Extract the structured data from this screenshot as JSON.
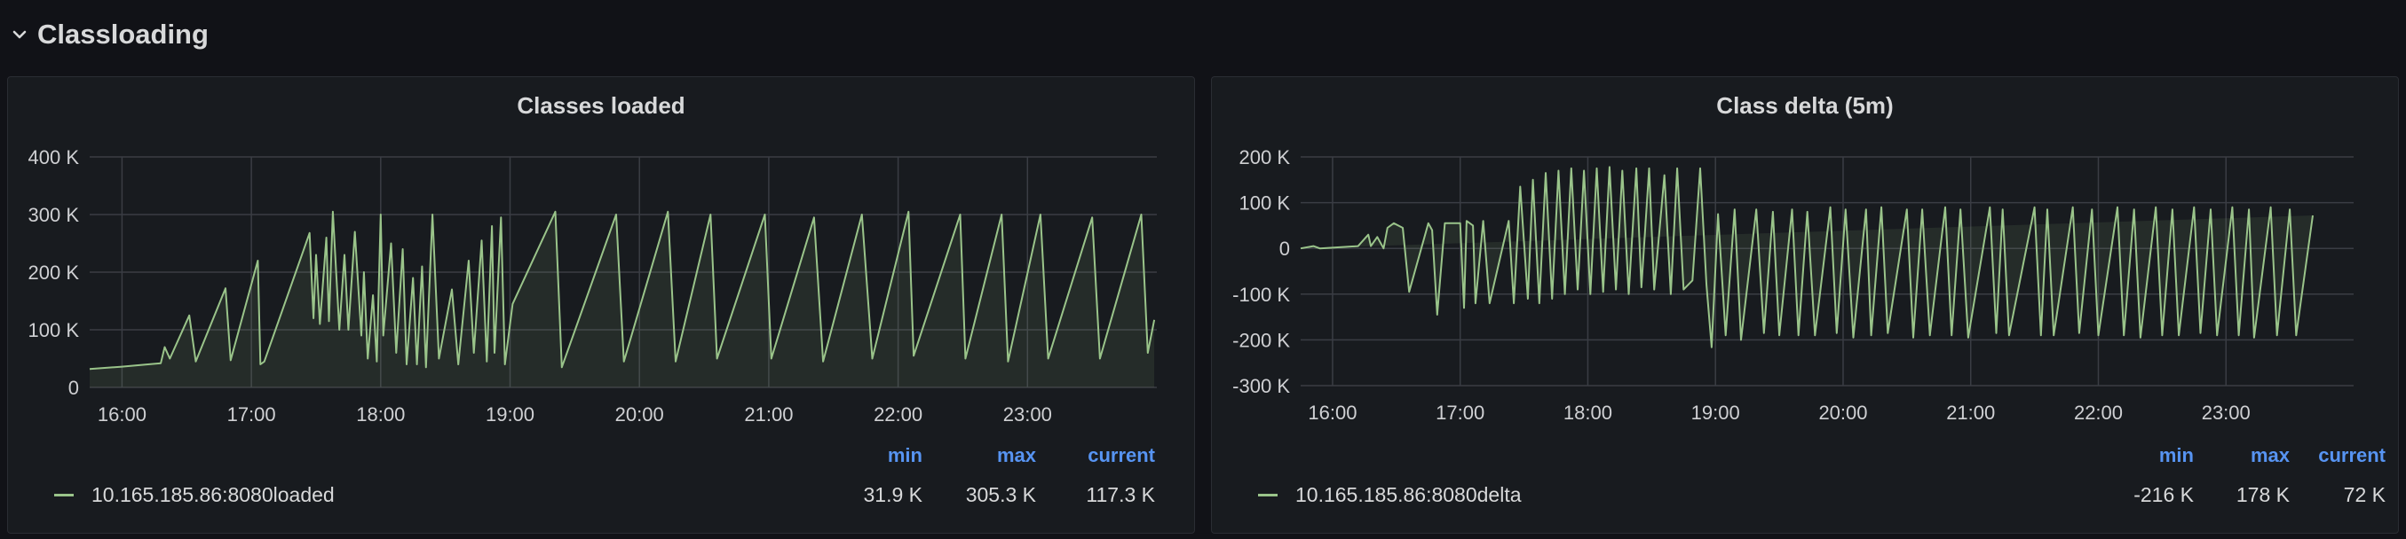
{
  "row": {
    "title": "Classloading",
    "icon": "chevron-down-icon"
  },
  "colors": {
    "series": "#9ac48a",
    "fill": "rgba(154,196,138,0.10)",
    "legend_header": "#5794f2"
  },
  "panels": [
    {
      "title": "Classes loaded",
      "legend": {
        "headers": [
          "min",
          "max",
          "current"
        ],
        "series_label": "10.165.185.86:8080loaded",
        "values": [
          "31.9 K",
          "305.3 K",
          "117.3 K"
        ]
      },
      "chart_data": {
        "type": "area",
        "title": "Classes loaded",
        "x_unit": "hours",
        "xlim": [
          15.75,
          24.0
        ],
        "ylim": [
          0,
          400
        ],
        "x_ticks": [
          16,
          17,
          18,
          19,
          20,
          21,
          22,
          23
        ],
        "x_tick_labels": [
          "16:00",
          "17:00",
          "18:00",
          "19:00",
          "20:00",
          "21:00",
          "22:00",
          "23:00"
        ],
        "y_ticks": [
          0,
          100,
          200,
          300,
          400
        ],
        "y_tick_labels": [
          "0",
          "100 K",
          "200 K",
          "300 K",
          "400 K"
        ],
        "series": [
          {
            "name": "10.165.185.86:8080loaded",
            "x": [
              15.75,
              16.0,
              16.2,
              16.3,
              16.33,
              16.37,
              16.52,
              16.57,
              16.8,
              16.84,
              17.05,
              17.07,
              17.1,
              17.45,
              17.48,
              17.5,
              17.53,
              17.58,
              17.6,
              17.63,
              17.68,
              17.72,
              17.75,
              17.8,
              17.85,
              17.87,
              17.9,
              17.94,
              17.97,
              18.0,
              18.02,
              18.08,
              18.12,
              18.17,
              18.2,
              18.25,
              18.28,
              18.32,
              18.35,
              18.4,
              18.45,
              18.55,
              18.6,
              18.68,
              18.72,
              18.78,
              18.82,
              18.86,
              18.88,
              18.93,
              18.96,
              19.02,
              19.35,
              19.4,
              19.82,
              19.88,
              20.22,
              20.28,
              20.55,
              20.6,
              20.97,
              21.02,
              21.35,
              21.42,
              21.72,
              21.8,
              22.08,
              22.12,
              22.48,
              22.52,
              22.8,
              22.85,
              23.1,
              23.16,
              23.5,
              23.56,
              23.88,
              23.93,
              23.98
            ],
            "y": [
              31.9,
              36,
              40,
              42,
              70,
              50,
              125,
              45,
              172,
              47,
              220,
              40,
              45,
              268,
              120,
              230,
              110,
              260,
              115,
              305,
              100,
              230,
              100,
              270,
              90,
              200,
              50,
              160,
              45,
              300,
              90,
              250,
              60,
              240,
              40,
              190,
              40,
              210,
              35,
              300,
              50,
              170,
              40,
              220,
              60,
              255,
              45,
              280,
              60,
              295,
              40,
              145,
              305,
              35,
              300,
              45,
              305,
              45,
              300,
              50,
              300,
              50,
              295,
              45,
              300,
              50,
              305,
              55,
              300,
              50,
              300,
              45,
              300,
              50,
              295,
              50,
              300,
              60,
              117.3
            ]
          }
        ]
      }
    },
    {
      "title": "Class delta (5m)",
      "legend": {
        "headers": [
          "min",
          "max",
          "current"
        ],
        "series_label": "10.165.185.86:8080delta",
        "values": [
          "-216 K",
          "178 K",
          "72 K"
        ]
      },
      "chart_data": {
        "type": "line",
        "title": "Class delta (5m)",
        "x_unit": "hours",
        "xlim": [
          15.75,
          24.0
        ],
        "ylim": [
          -300,
          200
        ],
        "x_ticks": [
          16,
          17,
          18,
          19,
          20,
          21,
          22,
          23
        ],
        "x_tick_labels": [
          "16:00",
          "17:00",
          "18:00",
          "19:00",
          "20:00",
          "21:00",
          "22:00",
          "23:00"
        ],
        "y_ticks": [
          -300,
          -200,
          -100,
          0,
          100,
          200
        ],
        "y_tick_labels": [
          "-300 K",
          "-200 K",
          "-100 K",
          "0",
          "100 K",
          "200 K"
        ],
        "series": [
          {
            "name": "10.165.185.86:8080delta",
            "x": [
              15.75,
              15.85,
              15.9,
              16.2,
              16.28,
              16.3,
              16.35,
              16.4,
              16.43,
              16.48,
              16.55,
              16.6,
              16.75,
              16.78,
              16.82,
              16.88,
              17.0,
              17.03,
              17.05,
              17.1,
              17.12,
              17.18,
              17.23,
              17.38,
              17.42,
              17.47,
              17.53,
              17.57,
              17.62,
              17.67,
              17.72,
              17.77,
              17.82,
              17.87,
              17.92,
              17.97,
              18.02,
              18.07,
              18.12,
              18.17,
              18.22,
              18.27,
              18.32,
              18.38,
              18.42,
              18.48,
              18.52,
              18.6,
              18.65,
              18.7,
              18.75,
              18.82,
              18.88,
              18.93,
              18.97,
              19.02,
              19.08,
              19.15,
              19.2,
              19.32,
              19.38,
              19.45,
              19.5,
              19.6,
              19.65,
              19.72,
              19.78,
              19.9,
              19.95,
              20.02,
              20.08,
              20.18,
              20.22,
              20.3,
              20.35,
              20.5,
              20.55,
              20.62,
              20.68,
              20.8,
              20.85,
              20.92,
              20.98,
              21.15,
              21.2,
              21.25,
              21.3,
              21.5,
              21.55,
              21.6,
              21.65,
              21.8,
              21.85,
              21.95,
              22.0,
              22.15,
              22.2,
              22.28,
              22.33,
              22.45,
              22.5,
              22.58,
              22.63,
              22.75,
              22.8,
              22.88,
              22.93,
              23.05,
              23.1,
              23.18,
              23.22,
              23.35,
              23.4,
              23.5,
              23.55,
              23.68,
              23.72,
              23.82,
              23.86,
              23.98
            ],
            "y": [
              0,
              5,
              0,
              5,
              30,
              5,
              25,
              0,
              45,
              55,
              45,
              -95,
              55,
              40,
              -145,
              55,
              55,
              -130,
              60,
              50,
              -120,
              60,
              -120,
              60,
              -120,
              135,
              -110,
              150,
              -120,
              165,
              -110,
              170,
              -100,
              175,
              -90,
              170,
              -100,
              175,
              -95,
              178,
              -90,
              170,
              -100,
              175,
              -85,
              175,
              -90,
              160,
              -100,
              175,
              -90,
              -70,
              175,
              -80,
              -216,
              75,
              -190,
              85,
              -200,
              85,
              -185,
              80,
              -190,
              85,
              -190,
              80,
              -190,
              90,
              -185,
              85,
              -195,
              85,
              -190,
              90,
              -185,
              85,
              -195,
              85,
              -190,
              90,
              -190,
              85,
              -195,
              90,
              -185,
              85,
              -190,
              90,
              -190,
              85,
              -190,
              90,
              -185,
              85,
              -190,
              90,
              -190,
              85,
              -195,
              90,
              -190,
              85,
              -190,
              90,
              -185,
              85,
              -190,
              90,
              -190,
              85,
              -195,
              90,
              -190,
              85,
              -190,
              72
            ]
          }
        ]
      }
    }
  ]
}
